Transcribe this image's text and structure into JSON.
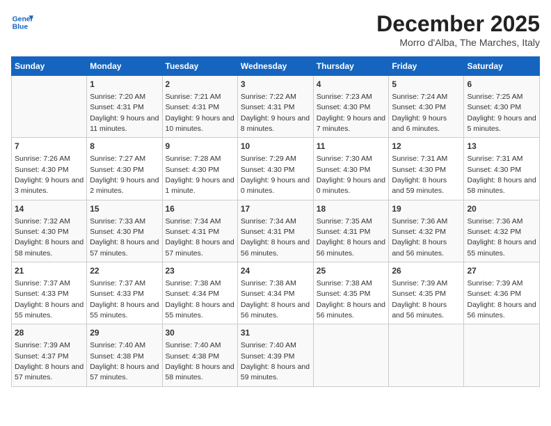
{
  "logo": {
    "line1": "General",
    "line2": "Blue"
  },
  "title": "December 2025",
  "location": "Morro d'Alba, The Marches, Italy",
  "days_header": [
    "Sunday",
    "Monday",
    "Tuesday",
    "Wednesday",
    "Thursday",
    "Friday",
    "Saturday"
  ],
  "weeks": [
    [
      {
        "day": "",
        "sunrise": "",
        "sunset": "",
        "daylight": ""
      },
      {
        "day": "1",
        "sunrise": "7:20 AM",
        "sunset": "4:31 PM",
        "daylight": "9 hours and 11 minutes."
      },
      {
        "day": "2",
        "sunrise": "7:21 AM",
        "sunset": "4:31 PM",
        "daylight": "9 hours and 10 minutes."
      },
      {
        "day": "3",
        "sunrise": "7:22 AM",
        "sunset": "4:31 PM",
        "daylight": "9 hours and 8 minutes."
      },
      {
        "day": "4",
        "sunrise": "7:23 AM",
        "sunset": "4:30 PM",
        "daylight": "9 hours and 7 minutes."
      },
      {
        "day": "5",
        "sunrise": "7:24 AM",
        "sunset": "4:30 PM",
        "daylight": "9 hours and 6 minutes."
      },
      {
        "day": "6",
        "sunrise": "7:25 AM",
        "sunset": "4:30 PM",
        "daylight": "9 hours and 5 minutes."
      }
    ],
    [
      {
        "day": "7",
        "sunrise": "7:26 AM",
        "sunset": "4:30 PM",
        "daylight": "9 hours and 3 minutes."
      },
      {
        "day": "8",
        "sunrise": "7:27 AM",
        "sunset": "4:30 PM",
        "daylight": "9 hours and 2 minutes."
      },
      {
        "day": "9",
        "sunrise": "7:28 AM",
        "sunset": "4:30 PM",
        "daylight": "9 hours and 1 minute."
      },
      {
        "day": "10",
        "sunrise": "7:29 AM",
        "sunset": "4:30 PM",
        "daylight": "9 hours and 0 minutes."
      },
      {
        "day": "11",
        "sunrise": "7:30 AM",
        "sunset": "4:30 PM",
        "daylight": "9 hours and 0 minutes."
      },
      {
        "day": "12",
        "sunrise": "7:31 AM",
        "sunset": "4:30 PM",
        "daylight": "8 hours and 59 minutes."
      },
      {
        "day": "13",
        "sunrise": "7:31 AM",
        "sunset": "4:30 PM",
        "daylight": "8 hours and 58 minutes."
      }
    ],
    [
      {
        "day": "14",
        "sunrise": "7:32 AM",
        "sunset": "4:30 PM",
        "daylight": "8 hours and 58 minutes."
      },
      {
        "day": "15",
        "sunrise": "7:33 AM",
        "sunset": "4:30 PM",
        "daylight": "8 hours and 57 minutes."
      },
      {
        "day": "16",
        "sunrise": "7:34 AM",
        "sunset": "4:31 PM",
        "daylight": "8 hours and 57 minutes."
      },
      {
        "day": "17",
        "sunrise": "7:34 AM",
        "sunset": "4:31 PM",
        "daylight": "8 hours and 56 minutes."
      },
      {
        "day": "18",
        "sunrise": "7:35 AM",
        "sunset": "4:31 PM",
        "daylight": "8 hours and 56 minutes."
      },
      {
        "day": "19",
        "sunrise": "7:36 AM",
        "sunset": "4:32 PM",
        "daylight": "8 hours and 56 minutes."
      },
      {
        "day": "20",
        "sunrise": "7:36 AM",
        "sunset": "4:32 PM",
        "daylight": "8 hours and 55 minutes."
      }
    ],
    [
      {
        "day": "21",
        "sunrise": "7:37 AM",
        "sunset": "4:33 PM",
        "daylight": "8 hours and 55 minutes."
      },
      {
        "day": "22",
        "sunrise": "7:37 AM",
        "sunset": "4:33 PM",
        "daylight": "8 hours and 55 minutes."
      },
      {
        "day": "23",
        "sunrise": "7:38 AM",
        "sunset": "4:34 PM",
        "daylight": "8 hours and 55 minutes."
      },
      {
        "day": "24",
        "sunrise": "7:38 AM",
        "sunset": "4:34 PM",
        "daylight": "8 hours and 56 minutes."
      },
      {
        "day": "25",
        "sunrise": "7:38 AM",
        "sunset": "4:35 PM",
        "daylight": "8 hours and 56 minutes."
      },
      {
        "day": "26",
        "sunrise": "7:39 AM",
        "sunset": "4:35 PM",
        "daylight": "8 hours and 56 minutes."
      },
      {
        "day": "27",
        "sunrise": "7:39 AM",
        "sunset": "4:36 PM",
        "daylight": "8 hours and 56 minutes."
      }
    ],
    [
      {
        "day": "28",
        "sunrise": "7:39 AM",
        "sunset": "4:37 PM",
        "daylight": "8 hours and 57 minutes."
      },
      {
        "day": "29",
        "sunrise": "7:40 AM",
        "sunset": "4:38 PM",
        "daylight": "8 hours and 57 minutes."
      },
      {
        "day": "30",
        "sunrise": "7:40 AM",
        "sunset": "4:38 PM",
        "daylight": "8 hours and 58 minutes."
      },
      {
        "day": "31",
        "sunrise": "7:40 AM",
        "sunset": "4:39 PM",
        "daylight": "8 hours and 59 minutes."
      },
      {
        "day": "",
        "sunrise": "",
        "sunset": "",
        "daylight": ""
      },
      {
        "day": "",
        "sunrise": "",
        "sunset": "",
        "daylight": ""
      },
      {
        "day": "",
        "sunrise": "",
        "sunset": "",
        "daylight": ""
      }
    ]
  ],
  "labels": {
    "sunrise_prefix": "Sunrise: ",
    "sunset_prefix": "Sunset: ",
    "daylight_prefix": "Daylight: "
  }
}
